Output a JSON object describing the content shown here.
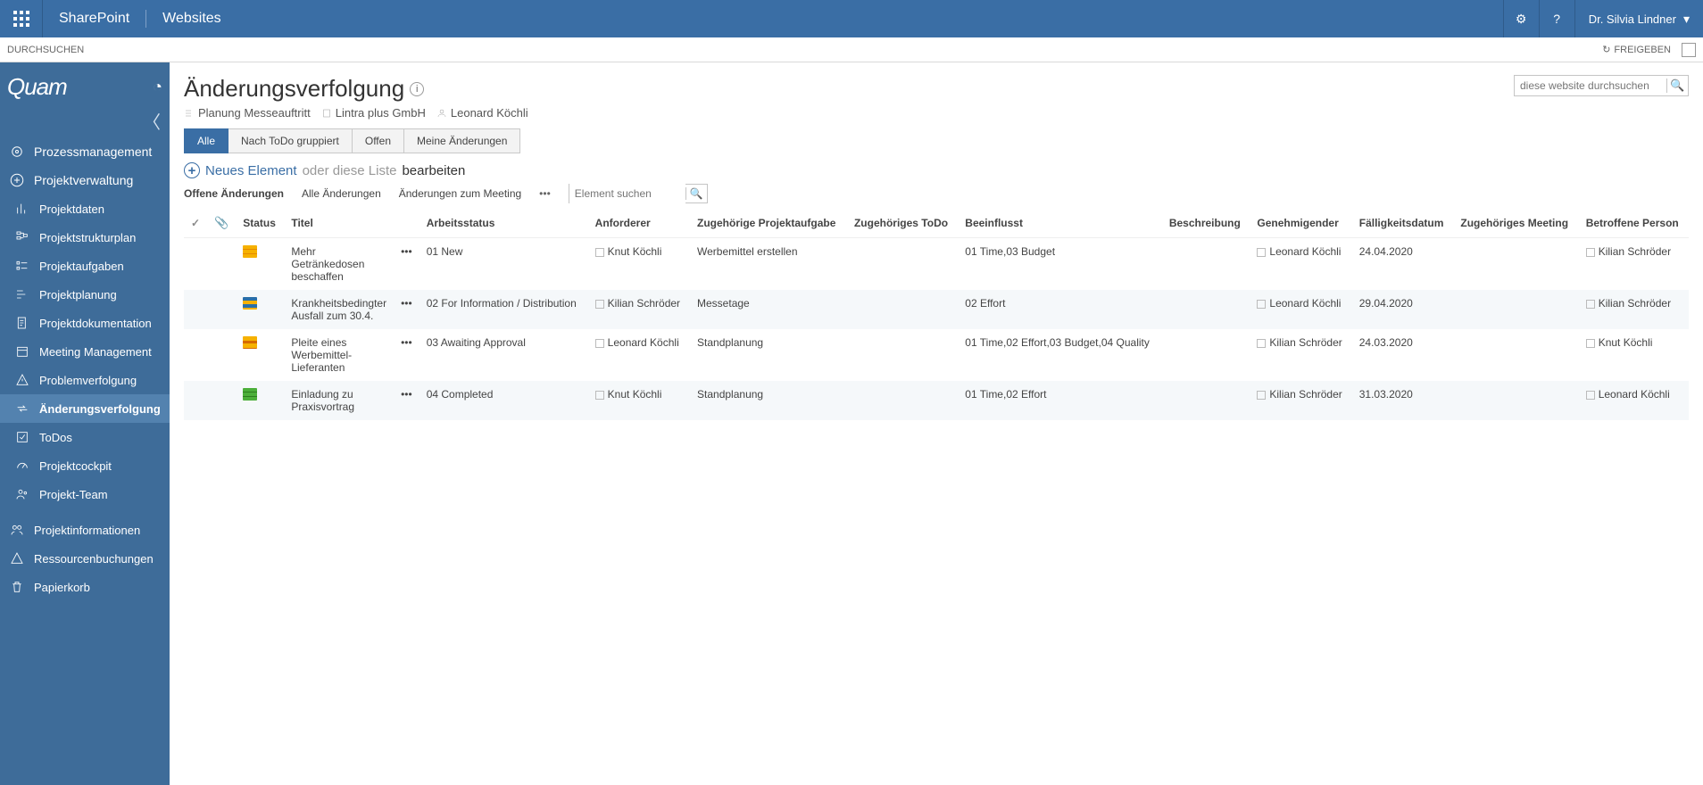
{
  "topbar": {
    "brand": "SharePoint",
    "section": "Websites",
    "user": "Dr. Silvia Lindner"
  },
  "ribbon": {
    "browse": "DURCHSUCHEN",
    "share": "FREIGEBEN"
  },
  "sidebar": {
    "logo": "Quam",
    "top1": "Prozessmanagement",
    "top2": "Projektverwaltung",
    "items": [
      "Projektdaten",
      "Projektstrukturplan",
      "Projektaufgaben",
      "Projektplanung",
      "Projektdokumentation",
      "Meeting Management",
      "Problemverfolgung",
      "Änderungsverfolgung",
      "ToDos",
      "Projektcockpit",
      "Projekt-Team"
    ],
    "bottom": [
      "Projektinformationen",
      "Ressourcenbuchungen",
      "Papierkorb"
    ]
  },
  "page": {
    "title": "Änderungsverfolgung",
    "crumb1": "Planung Messeauftritt",
    "crumb2": "Lintra plus GmbH",
    "crumb3": "Leonard Köchli",
    "search_placeholder": "diese website durchsuchen"
  },
  "tabs": [
    "Alle",
    "Nach ToDo gruppiert",
    "Offen",
    "Meine Änderungen"
  ],
  "newline": {
    "bold": "Neues Element",
    "mid": " oder diese Liste ",
    "end": "bearbeiten"
  },
  "filters": {
    "a": "Offene Änderungen",
    "b": "Alle Änderungen",
    "c": "Änderungen zum Meeting",
    "search_placeholder": "Element suchen"
  },
  "columns": {
    "status": "Status",
    "titel": "Titel",
    "arbeit": "Arbeitsstatus",
    "anforderer": "Anforderer",
    "aufgabe": "Zugehörige Projektaufgabe",
    "todo": "Zugehöriges ToDo",
    "beeinflusst": "Beeinflusst",
    "beschreibung": "Beschreibung",
    "genehmigender": "Genehmigender",
    "faelligkeit": "Fälligkeitsdatum",
    "meeting": "Zugehöriges Meeting",
    "betroffen": "Betroffene Person"
  },
  "rows": [
    {
      "chip": "chip-yellow",
      "titel": "Mehr Getränkedosen beschaffen",
      "arbeit": "01 New",
      "anforderer": "Knut Köchli",
      "aufgabe": "Werbemittel erstellen",
      "beeinflusst": "01 Time,03 Budget",
      "genehmigender": "Leonard Köchli",
      "faelligkeit": "24.04.2020",
      "betroffen": "Kilian Schröder"
    },
    {
      "chip": "chip-blue",
      "titel": "Krankheitsbedingter Ausfall zum 30.4.",
      "arbeit": "02 For Information / Distribution",
      "anforderer": "Kilian Schröder",
      "aufgabe": "Messetage",
      "beeinflusst": "02 Effort",
      "genehmigender": "Leonard Köchli",
      "faelligkeit": "29.04.2020",
      "betroffen": "Kilian Schröder"
    },
    {
      "chip": "chip-orange",
      "titel": "Pleite eines Werbemittel-Lieferanten",
      "arbeit": "03 Awaiting Approval",
      "anforderer": "Leonard Köchli",
      "aufgabe": "Standplanung",
      "beeinflusst": "01 Time,02 Effort,03 Budget,04 Quality",
      "genehmigender": "Kilian Schröder",
      "faelligkeit": "24.03.2020",
      "betroffen": "Knut Köchli"
    },
    {
      "chip": "chip-green",
      "titel": "Einladung zu Praxisvortrag",
      "arbeit": "04 Completed",
      "anforderer": "Knut Köchli",
      "aufgabe": "Standplanung",
      "beeinflusst": "01 Time,02 Effort",
      "genehmigender": "Kilian Schröder",
      "faelligkeit": "31.03.2020",
      "betroffen": "Leonard Köchli"
    }
  ]
}
